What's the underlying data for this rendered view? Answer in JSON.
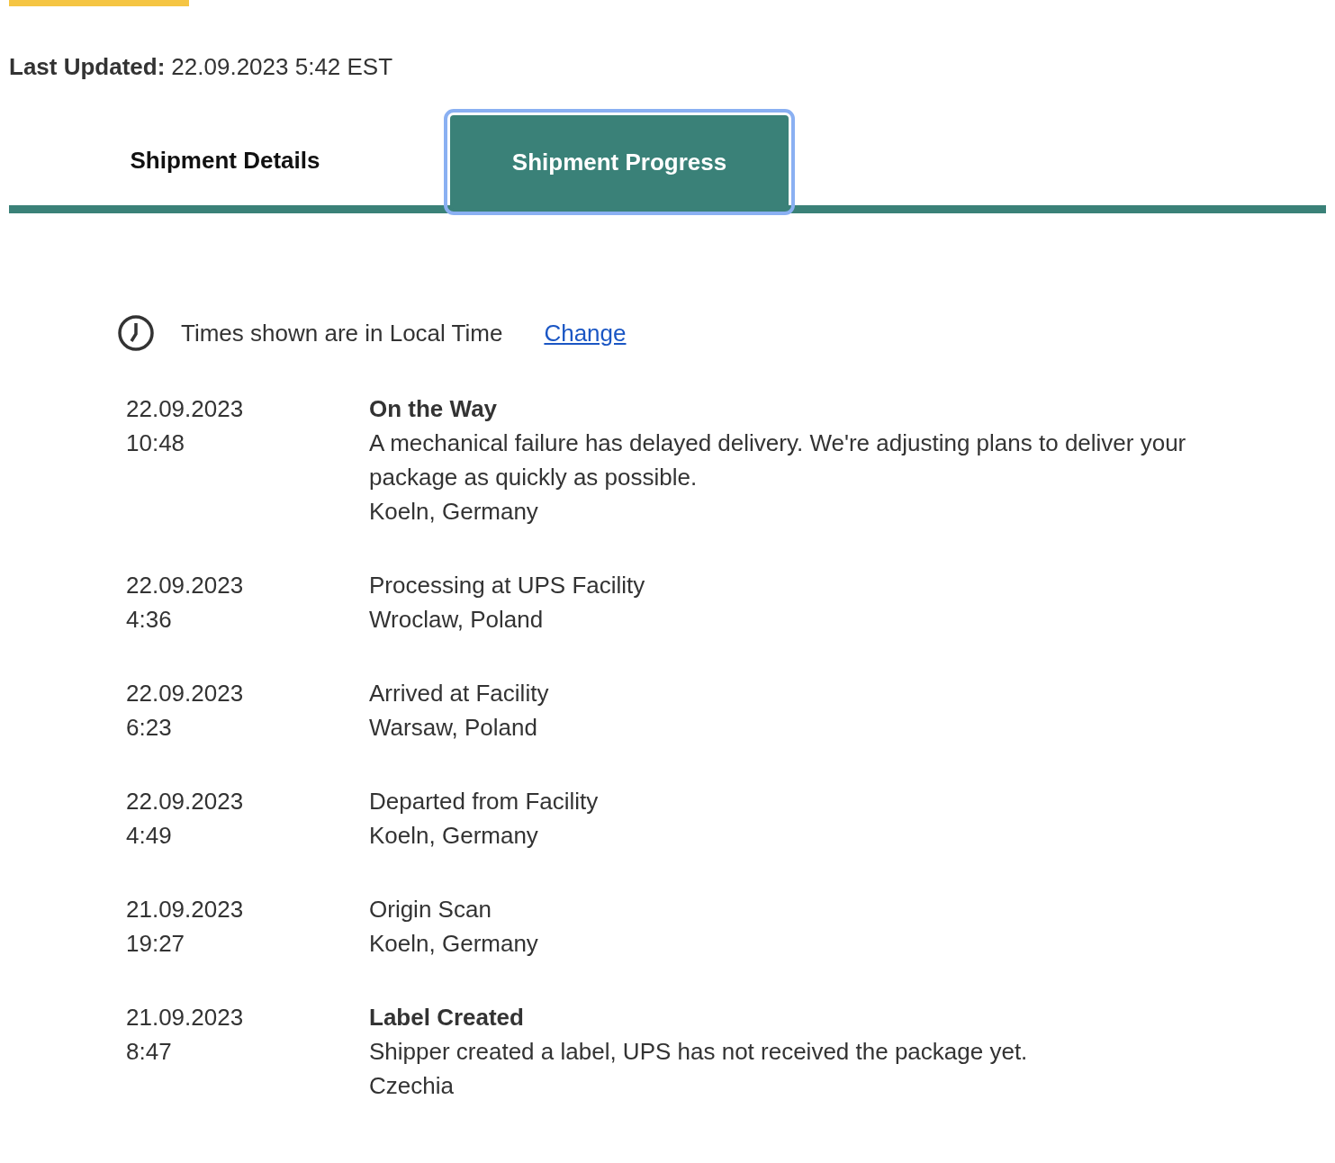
{
  "last_updated": {
    "label": "Last Updated:",
    "value": "22.09.2023 5:42 EST"
  },
  "tabs": [
    {
      "label": "Shipment Details",
      "selected": false
    },
    {
      "label": "Shipment Progress",
      "selected": true
    }
  ],
  "time_note": {
    "text": "Times shown are in Local Time",
    "link": "Change"
  },
  "events": [
    {
      "date": "22.09.2023",
      "time": "10:48",
      "kind": "milestone",
      "status": "On the Way",
      "description": "A mechanical failure has delayed delivery. We're adjusting plans to deliver your package as quickly as possible.",
      "location": "Koeln, Germany"
    },
    {
      "date": "22.09.2023",
      "time": "4:36",
      "kind": "scan",
      "status": "Processing at UPS Facility",
      "location": "Wroclaw, Poland"
    },
    {
      "date": "22.09.2023",
      "time": "6:23",
      "kind": "scan",
      "status": "Arrived at Facility",
      "location": "Warsaw, Poland"
    },
    {
      "date": "22.09.2023",
      "time": "4:49",
      "kind": "scan",
      "status": "Departed from Facility",
      "location": "Koeln, Germany"
    },
    {
      "date": "21.09.2023",
      "time": "19:27",
      "kind": "scan",
      "status": "Origin Scan",
      "location": "Koeln, Germany"
    },
    {
      "date": "21.09.2023",
      "time": "8:47",
      "kind": "milestone",
      "status": "Label Created",
      "description": "Shipper created a label, UPS has not received the package yet.",
      "location": "Czechia"
    }
  ]
}
